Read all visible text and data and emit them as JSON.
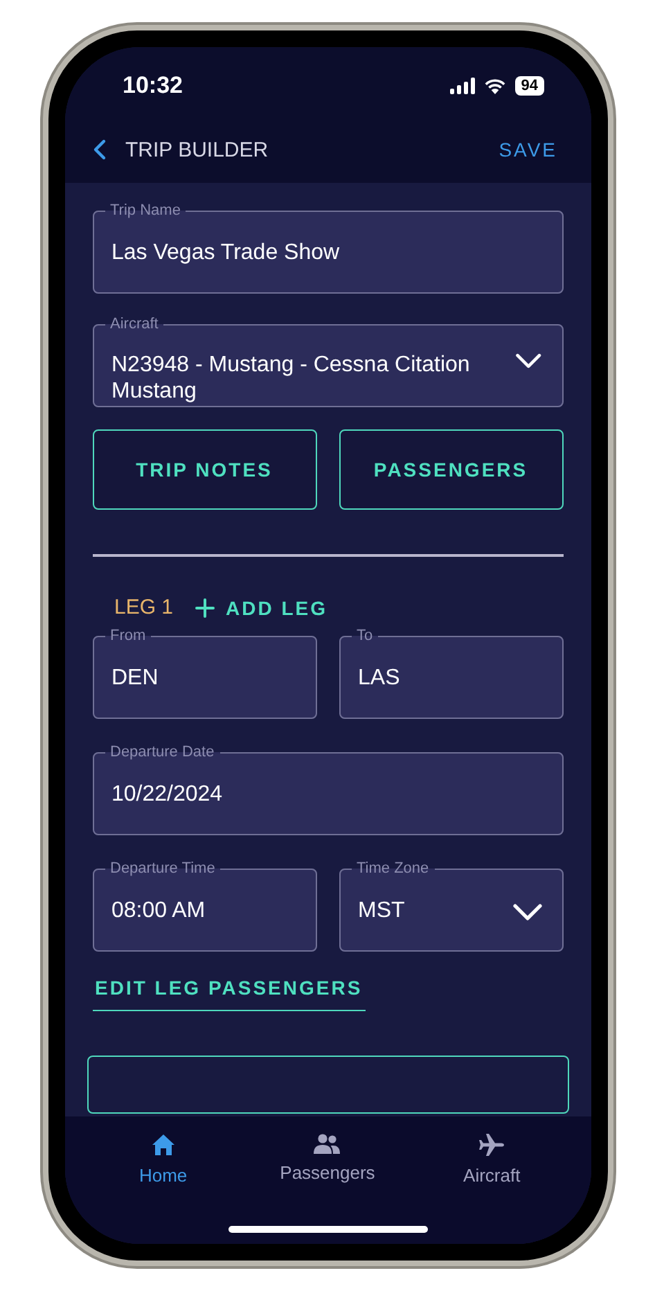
{
  "status_bar": {
    "time": "10:32",
    "battery": "94"
  },
  "header": {
    "title": "TRIP BUILDER",
    "action": "SAVE"
  },
  "trip_fields": [
    {
      "label": "Trip Name",
      "value": "Las Vegas Trade Show",
      "kind": "text"
    },
    {
      "label": "Aircraft",
      "value": "N23948 - Mustang - Cessna Citation Mustang",
      "kind": "select"
    }
  ],
  "buttons": [
    "TRIP NOTES",
    "PASSENGERS"
  ],
  "leg": {
    "title": "LEG 1",
    "add_label": "ADD LEG",
    "rows": [
      [
        {
          "label": "From",
          "value": "DEN",
          "kind": "text"
        },
        {
          "label": "To",
          "value": "LAS",
          "kind": "text"
        }
      ],
      [
        {
          "label": "Departure Date",
          "value": "10/22/2024",
          "kind": "text"
        }
      ],
      [
        {
          "label": "Departure Time",
          "value": "08:00 AM",
          "kind": "text"
        },
        {
          "label": "Time Zone",
          "value": "MST",
          "kind": "select"
        }
      ]
    ],
    "edit_link": "EDIT LEG PASSENGERS"
  },
  "tab_bar": [
    {
      "label": "Home",
      "selected": true
    },
    {
      "label": "Passengers",
      "selected": false
    },
    {
      "label": "Aircraft",
      "selected": false
    }
  ]
}
